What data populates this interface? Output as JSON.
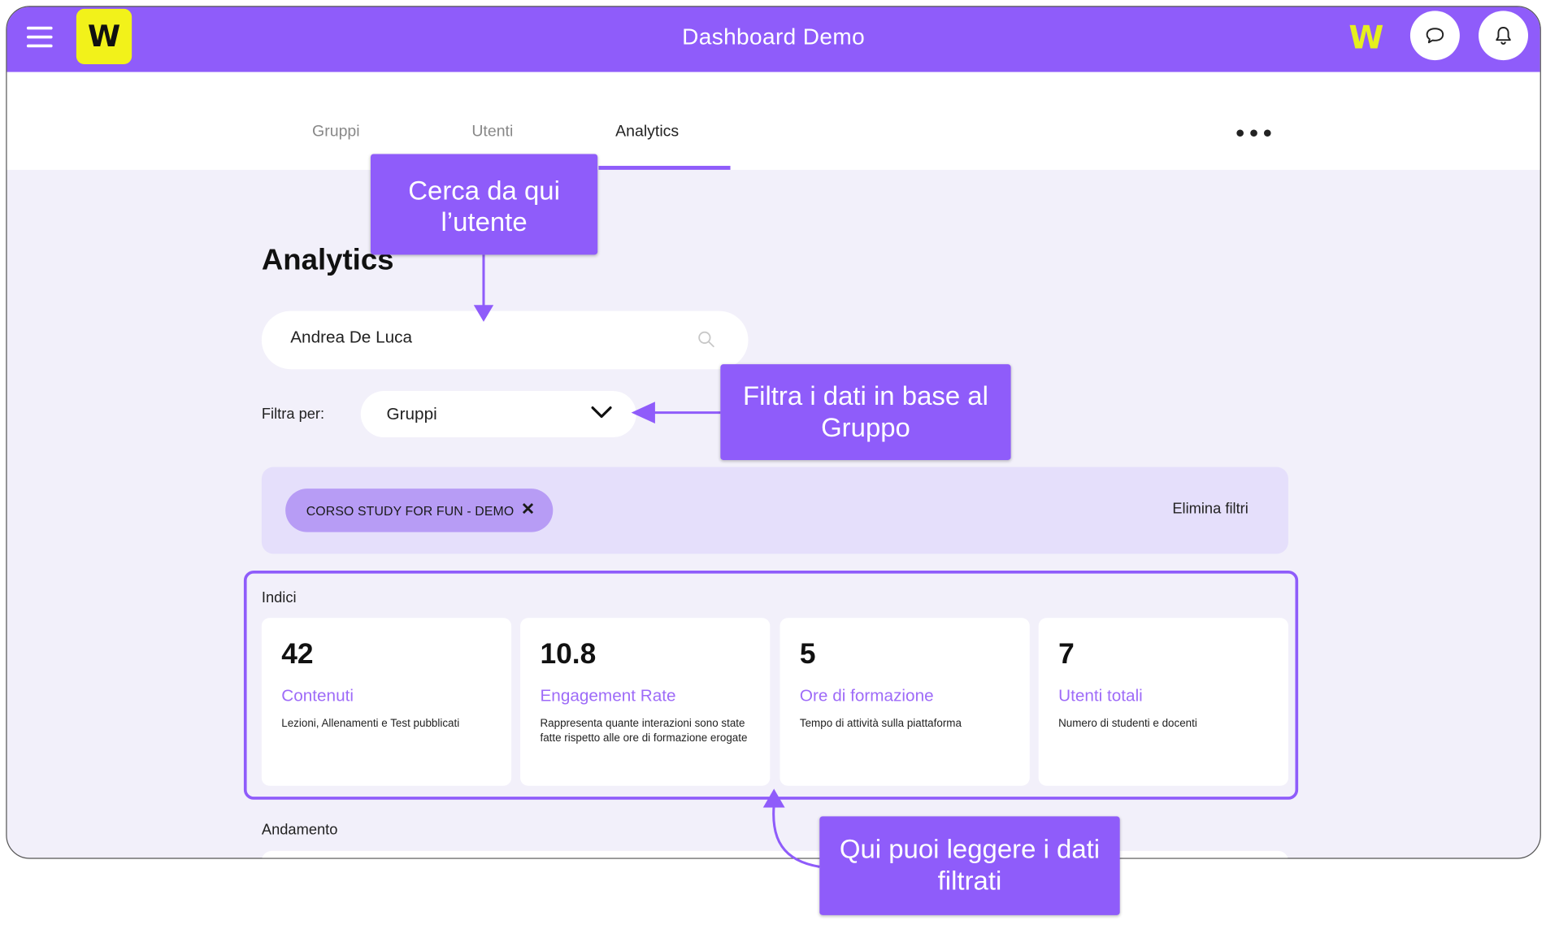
{
  "app": {
    "title": "Dashboard Demo",
    "logo_letter": "W",
    "brand_mark": "W",
    "accent": "#8f5cfa",
    "logo_color": "#f2f21a"
  },
  "icons": {
    "menu": "hamburger-icon",
    "chat": "chat-bubble-icon",
    "notifications": "bell-icon",
    "search": "search-icon",
    "dropdown": "chevron-down-icon",
    "remove_chip": "close-icon",
    "more": "more-horizontal-icon"
  },
  "tabs": [
    {
      "label": "Gruppi",
      "active": false
    },
    {
      "label": "Utenti",
      "active": false
    },
    {
      "label": "Analytics",
      "active": true
    }
  ],
  "more_label": "•••",
  "page": {
    "title": "Analytics",
    "search": {
      "value": "Andrea De Luca",
      "placeholder": ""
    },
    "filter": {
      "label": "Filtra per:",
      "selected": "Gruppi"
    },
    "active_filters": [
      {
        "label": "CORSO STUDY FOR FUN - DEMO",
        "remove": "✕"
      }
    ],
    "clear_filters": "Elimina filtri",
    "indici_label": "Indici",
    "indici": [
      {
        "value": "42",
        "title": "Contenuti",
        "description": "Lezioni, Allenamenti e Test pubblicati"
      },
      {
        "value": "10.8",
        "title": "Engagement Rate",
        "description": "Rappresenta quante interazioni sono state fatte rispetto alle ore di formazione erogate"
      },
      {
        "value": "5",
        "title": "Ore di formazione",
        "description": "Tempo di attività sulla piattaforma"
      },
      {
        "value": "7",
        "title": "Utenti totali",
        "description": "Numero di studenti e docenti"
      }
    ],
    "andamento_label": "Andamento"
  },
  "callouts": {
    "search": "Cerca da qui l’utente",
    "filter": "Filtra i dati in base al Gruppo",
    "results": "Qui puoi leggere i dati filtrati"
  }
}
